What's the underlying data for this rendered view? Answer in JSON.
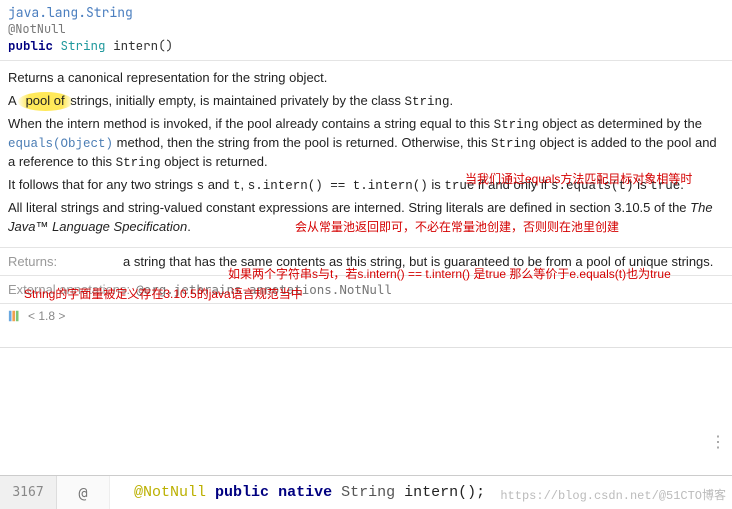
{
  "header": {
    "package": "java.lang.String",
    "annotation": "@NotNull",
    "sig_modifier": "public",
    "sig_type": "String",
    "sig_name": "intern()"
  },
  "body": {
    "p1": "Returns a canonical representation for the string object.",
    "p1_hl": "pool of",
    "p2a": "A ",
    "p2b": " strings, initially empty, is maintained privately by the class ",
    "p2c": "String",
    "p2d": ".",
    "p3a": "When the intern method is invoked, if the pool already contains a string equal to this ",
    "p3b": "String",
    "p3c": " object as determined by the ",
    "p3link": "equals(Object)",
    "p3d": " method, then the string from the pool is returned. Otherwise, this ",
    "p3e": "String",
    "p3f": " object is added to the pool and a reference to this ",
    "p3g": "String",
    "p3h": " object is returned.",
    "p4a": "It follows that for any two strings ",
    "p4b": "s",
    "p4c": " and ",
    "p4d": "t",
    "p4e": ", ",
    "p4f": "s.intern() == t.intern()",
    "p4g": " is ",
    "p4h": "true",
    "p4i": " if and only if ",
    "p4j": "s.equals(t)",
    "p4k": " is ",
    "p4l": "true",
    "p4m": ".",
    "p5a": "All literal strings and string-valued constant expressions are interned. String literals are defined in section 3.10.5 of the ",
    "p5b": "The Java™ Language Specification",
    "p5c": "."
  },
  "notes": {
    "n1": "当我们通过equals方法匹配目标对象相等时",
    "n2": "会从常量池返回即可，不必在常量池创建，否则则在池里创建",
    "n3": "如果两个字符串s与t，若s.intern() ==  t.intern() 是true 那么等价于e.equals(t)也为true",
    "n4": "String的字面量被定义存在3.10.5的java语言规范当中"
  },
  "returns": {
    "label": "Returns:",
    "text": "a string that has the same contents as this string, but is guaranteed to be from a pool of unique strings."
  },
  "external": {
    "label": "External annotations:",
    "value": "@org.jetbrains.annotations.NotNull"
  },
  "version": {
    "text": "< 1.8 >"
  },
  "footer": {
    "line_no": "3167",
    "gutter_icon": "@",
    "code_annotation": "@NotNull",
    "code_public": "public",
    "code_native": "native",
    "code_type": "String",
    "code_name": "intern();"
  },
  "watermark": "https://blog.csdn.net/@51CTO博客",
  "menu_icon": "⋮"
}
